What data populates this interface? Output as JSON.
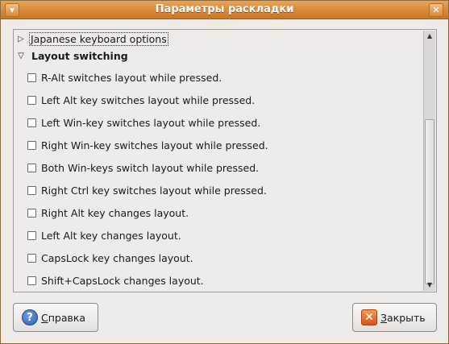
{
  "window": {
    "title": "Параметры раскладки",
    "menu_icon": "window-menu-icon",
    "close_icon": "window-close-icon"
  },
  "tree": {
    "collapsed_group": {
      "label": "Japanese keyboard options",
      "expanded": false
    },
    "expanded_group": {
      "label": "Layout switching",
      "expanded": true,
      "options": [
        {
          "label": "R-Alt switches layout while pressed.",
          "checked": false
        },
        {
          "label": "Left Alt key switches layout while pressed.",
          "checked": false
        },
        {
          "label": "Left Win-key switches layout while pressed.",
          "checked": false
        },
        {
          "label": "Right Win-key switches layout while pressed.",
          "checked": false
        },
        {
          "label": "Both Win-keys switch layout while pressed.",
          "checked": false
        },
        {
          "label": "Right Ctrl key switches layout while pressed.",
          "checked": false
        },
        {
          "label": "Right Alt key changes layout.",
          "checked": false
        },
        {
          "label": "Left Alt key changes layout.",
          "checked": false
        },
        {
          "label": "CapsLock key changes layout.",
          "checked": false
        },
        {
          "label": "Shift+CapsLock changes layout.",
          "checked": false
        }
      ]
    }
  },
  "buttons": {
    "help": {
      "mnemonic": "С",
      "rest": "правка",
      "icon": "help-icon"
    },
    "close": {
      "mnemonic": "З",
      "rest": "акрыть",
      "icon": "close-icon"
    }
  },
  "colors": {
    "titlebar": "#d98a35",
    "background": "#efebe7"
  }
}
